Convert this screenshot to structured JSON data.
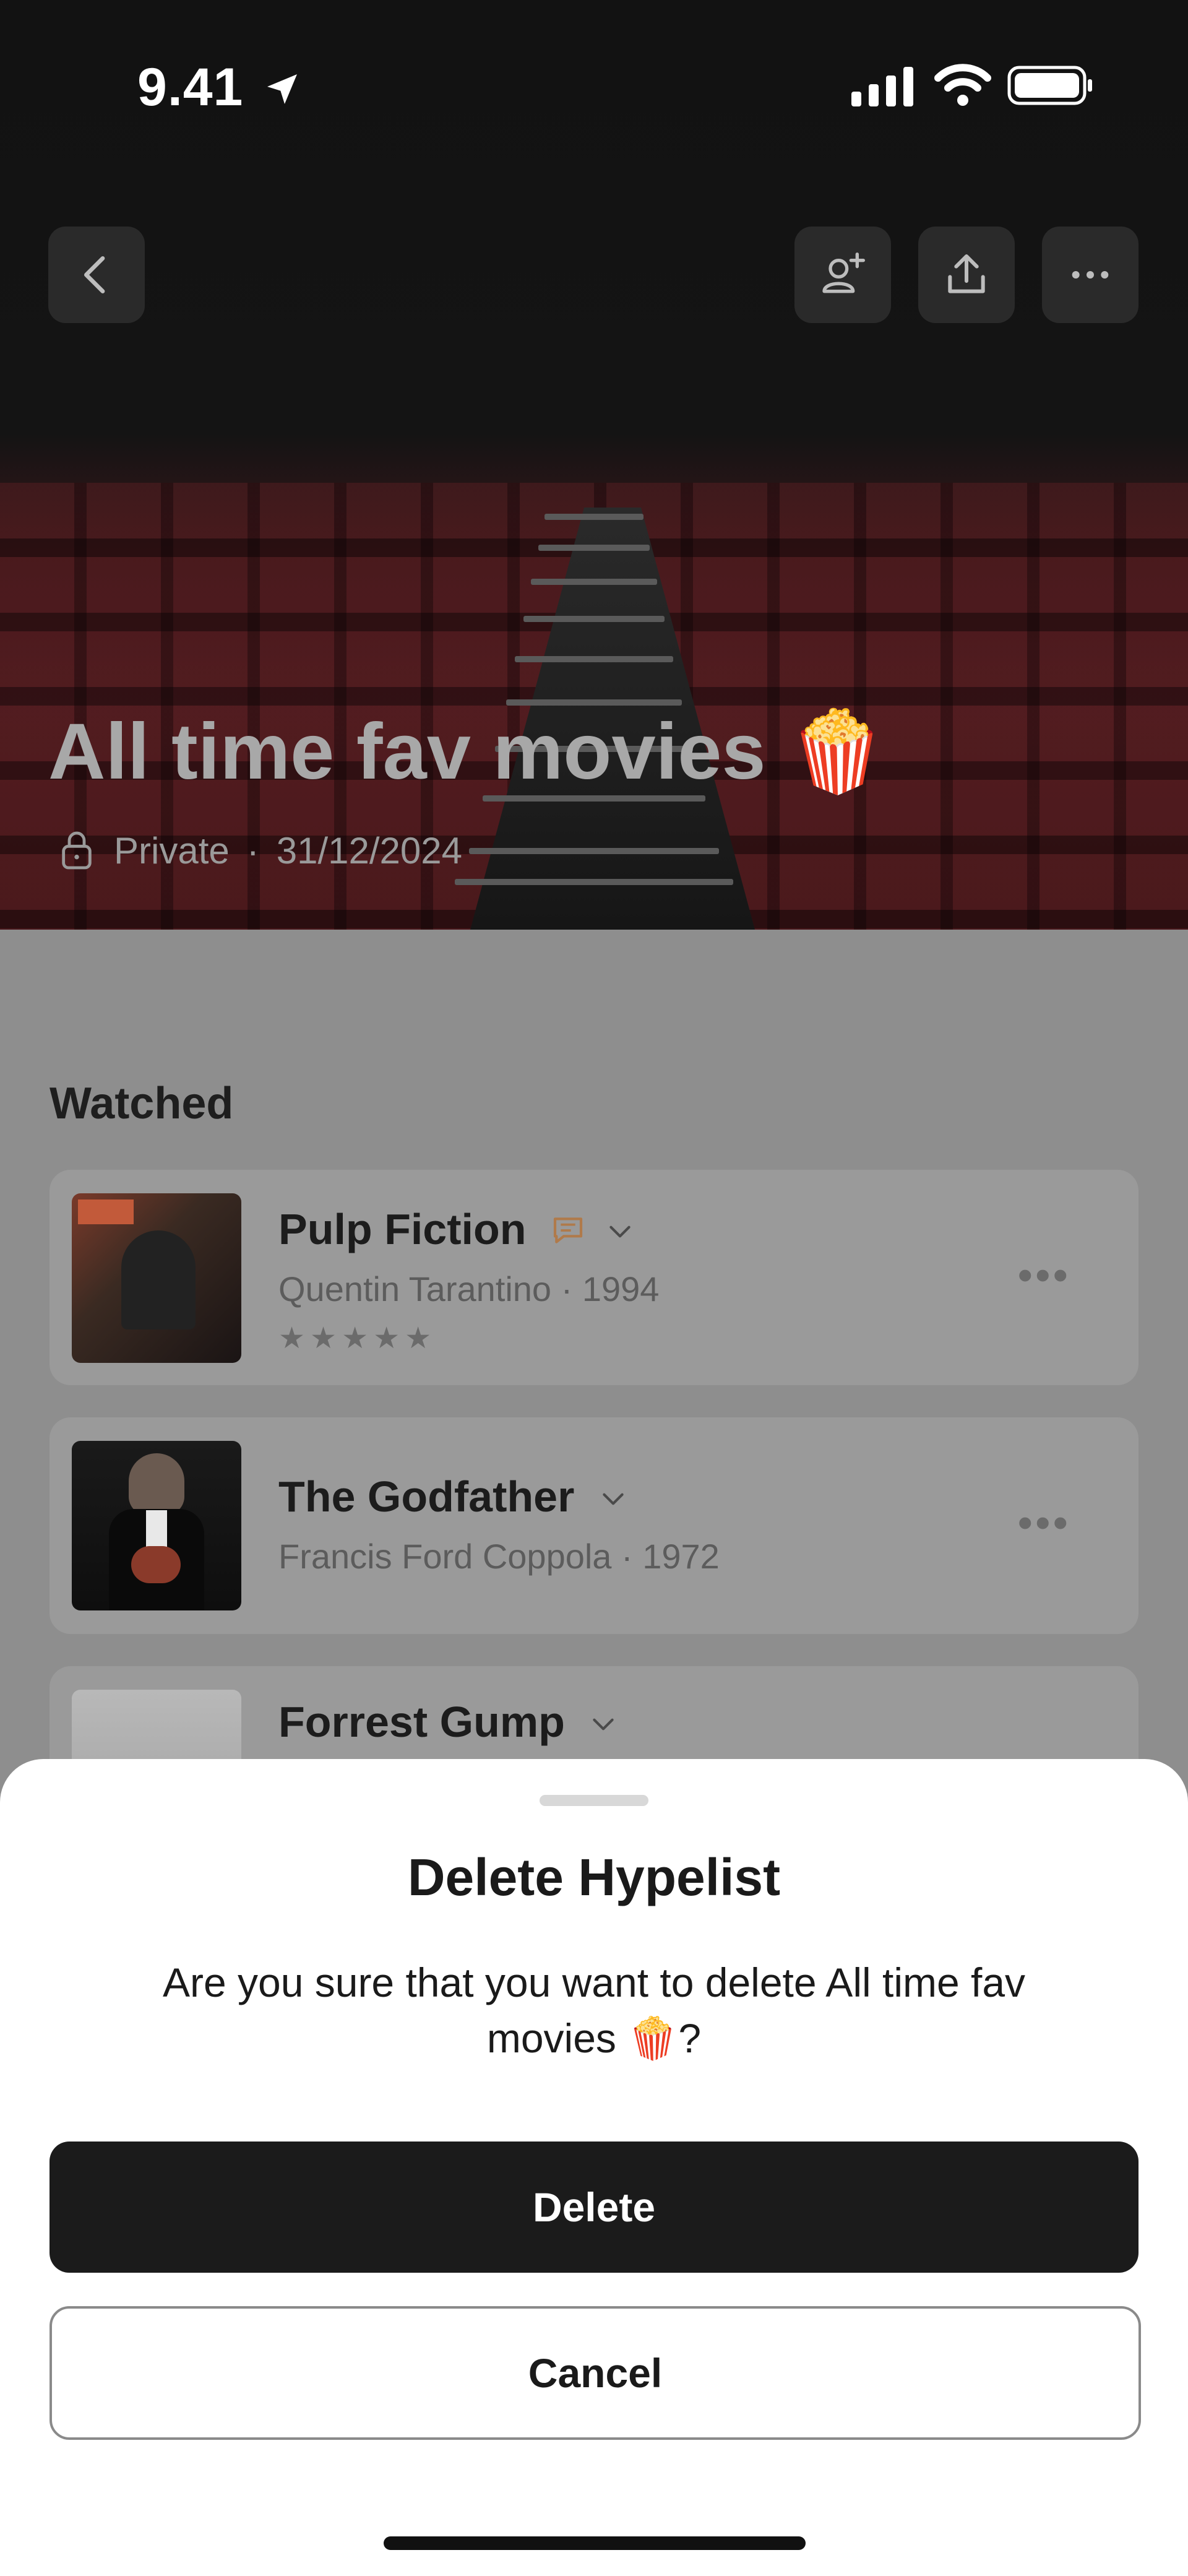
{
  "status_bar": {
    "time": "9.41"
  },
  "hypelist": {
    "title": "All time fav movies 🍿",
    "privacy": "Private",
    "separator": "·",
    "date": "31/12/2024"
  },
  "section": {
    "title": "Watched"
  },
  "movies": [
    {
      "title": "Pulp Fiction",
      "subtitle": "Quentin Tarantino · 1994",
      "rating": 5,
      "stars": "★★★★★"
    },
    {
      "title": "The Godfather",
      "subtitle": "Francis Ford Coppola · 1972"
    },
    {
      "title": "Forrest Gump"
    }
  ],
  "dialog": {
    "title": "Delete Hypelist",
    "message": "Are you sure that you want to delete All time fav movies 🍿?",
    "delete_label": "Delete",
    "cancel_label": "Cancel"
  },
  "icons": [
    "location-arrow-icon",
    "signal-icon",
    "wifi-icon",
    "battery-icon",
    "back-icon",
    "add-collaborator-icon",
    "share-icon",
    "more-icon",
    "lock-icon",
    "comment-icon",
    "chevron-down-icon"
  ],
  "colors": {
    "dialog_bg": "#ffffff",
    "primary_button": "#1b1b1b",
    "comment_icon": "#b07a4a"
  }
}
